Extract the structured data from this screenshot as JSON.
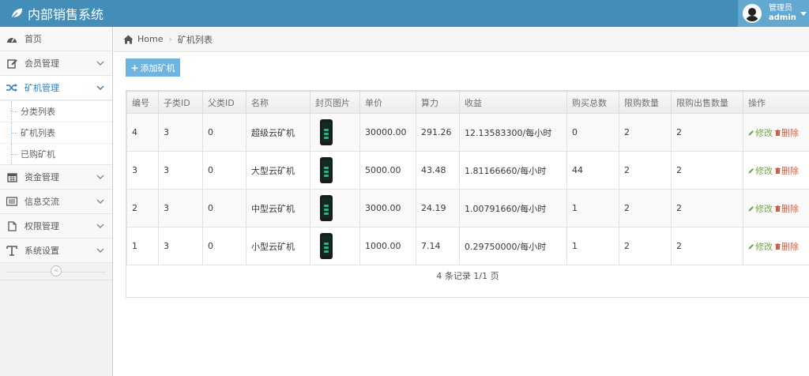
{
  "app": {
    "title": "内部销售系统"
  },
  "user": {
    "role": "管理员",
    "name": "admin"
  },
  "sidebar": {
    "items": [
      {
        "label": "首页",
        "icon": "dashboard-icon"
      },
      {
        "label": "会员管理",
        "icon": "edit-icon"
      },
      {
        "label": "矿机管理",
        "icon": "random-icon",
        "active": true
      },
      {
        "label": "资金管理",
        "icon": "calendar-icon"
      },
      {
        "label": "信息交流",
        "icon": "list-icon"
      },
      {
        "label": "权限管理",
        "icon": "file-icon"
      },
      {
        "label": "系统设置",
        "icon": "text-icon"
      }
    ],
    "submenu": [
      "分类列表",
      "矿机列表",
      "已购矿机"
    ],
    "collapse_label": "«"
  },
  "breadcrumb": {
    "home": "Home",
    "current": "矿机列表"
  },
  "toolbar": {
    "add_label": "添加矿机"
  },
  "table": {
    "headers": [
      "编号",
      "子类ID",
      "父类ID",
      "名称",
      "封页图片",
      "单价",
      "算力",
      "收益",
      "购买总数",
      "限购数量",
      "限购出售数量",
      "操作"
    ],
    "rows": [
      {
        "id": "4",
        "sub_id": "3",
        "parent_id": "0",
        "name": "超级云矿机",
        "price": "30000.00",
        "power": "291.26",
        "income": "12.13583300/每小时",
        "total": "0",
        "limit": "2",
        "sell_limit": "2"
      },
      {
        "id": "3",
        "sub_id": "3",
        "parent_id": "0",
        "name": "大型云矿机",
        "price": "5000.00",
        "power": "43.48",
        "income": "1.81166660/每小时",
        "total": "44",
        "limit": "2",
        "sell_limit": "2"
      },
      {
        "id": "2",
        "sub_id": "3",
        "parent_id": "0",
        "name": "中型云矿机",
        "price": "3000.00",
        "power": "24.19",
        "income": "1.00791660/每小时",
        "total": "1",
        "limit": "2",
        "sell_limit": "2"
      },
      {
        "id": "1",
        "sub_id": "3",
        "parent_id": "0",
        "name": "小型云矿机",
        "price": "1000.00",
        "power": "7.14",
        "income": "0.29750000/每小时",
        "total": "1",
        "limit": "2",
        "sell_limit": "2"
      }
    ],
    "edit_label": "修改",
    "delete_label": "删除"
  },
  "pager": {
    "text": "4 条记录 1/1 页"
  },
  "colors": {
    "navbar": "#438eb9",
    "accent": "#6fb3e0",
    "edit": "#69aa46",
    "delete": "#dd5a43"
  }
}
